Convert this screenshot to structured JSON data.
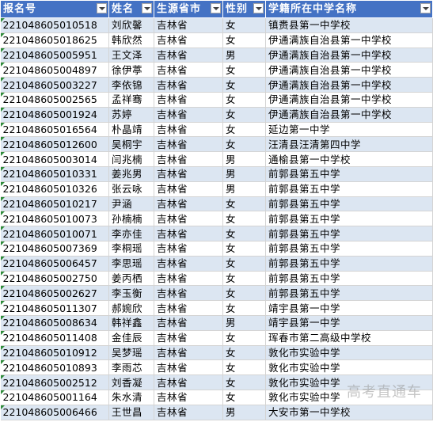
{
  "headers": [
    "报名号",
    "姓名",
    "生源省市",
    "性别",
    "学籍所在中学名称"
  ],
  "rows": [
    {
      "id": "221048605010518",
      "name": "刘欣馨",
      "province": "吉林省",
      "gender": "女",
      "school": "镇赉县第一中学校"
    },
    {
      "id": "221048605018625",
      "name": "韩欣然",
      "province": "吉林省",
      "gender": "女",
      "school": "伊通满族自治县第一中学校"
    },
    {
      "id": "221048605005951",
      "name": "王文泽",
      "province": "吉林省",
      "gender": "男",
      "school": "伊通满族自治县第一中学校"
    },
    {
      "id": "221048605004897",
      "name": "徐伊葶",
      "province": "吉林省",
      "gender": "女",
      "school": "伊通满族自治县第一中学校"
    },
    {
      "id": "221048605003227",
      "name": "李依锦",
      "province": "吉林省",
      "gender": "女",
      "school": "伊通满族自治县第一中学校"
    },
    {
      "id": "221048605002565",
      "name": "孟祥骞",
      "province": "吉林省",
      "gender": "女",
      "school": "伊通满族自治县第一中学校"
    },
    {
      "id": "221048605001924",
      "name": "苏婷",
      "province": "吉林省",
      "gender": "女",
      "school": "伊通满族自治县第一中学校"
    },
    {
      "id": "221048605016564",
      "name": "朴晶靖",
      "province": "吉林省",
      "gender": "女",
      "school": "延边第一中学"
    },
    {
      "id": "221048605012600",
      "name": "吴桐宇",
      "province": "吉林省",
      "gender": "女",
      "school": "汪清县汪清第四中学"
    },
    {
      "id": "221048605003014",
      "name": "闫兆楠",
      "province": "吉林省",
      "gender": "男",
      "school": "通榆县第一中学校"
    },
    {
      "id": "221048605010331",
      "name": "姜兆男",
      "province": "吉林省",
      "gender": "男",
      "school": "前郭县第五中学"
    },
    {
      "id": "221048605010326",
      "name": "张云咏",
      "province": "吉林省",
      "gender": "男",
      "school": "前郭县第五中学"
    },
    {
      "id": "221048605010217",
      "name": "尹涵",
      "province": "吉林省",
      "gender": "女",
      "school": "前郭县第五中学"
    },
    {
      "id": "221048605010073",
      "name": "孙楠楠",
      "province": "吉林省",
      "gender": "女",
      "school": "前郭县第五中学"
    },
    {
      "id": "221048605010071",
      "name": "李亦佳",
      "province": "吉林省",
      "gender": "女",
      "school": "前郭县第五中学"
    },
    {
      "id": "221048605007369",
      "name": "李桐瑶",
      "province": "吉林省",
      "gender": "女",
      "school": "前郭县第五中学"
    },
    {
      "id": "221048605006457",
      "name": "李思瑶",
      "province": "吉林省",
      "gender": "女",
      "school": "前郭县第五中学"
    },
    {
      "id": "221048605002750",
      "name": "姜丙栖",
      "province": "吉林省",
      "gender": "女",
      "school": "前郭县第五中学"
    },
    {
      "id": "221048605002627",
      "name": "李玉衡",
      "province": "吉林省",
      "gender": "女",
      "school": "前郭县第五中学"
    },
    {
      "id": "221048605011307",
      "name": "郝婉欣",
      "province": "吉林省",
      "gender": "女",
      "school": "靖宇县第一中学"
    },
    {
      "id": "221048605008634",
      "name": "韩祥鑫",
      "province": "吉林省",
      "gender": "男",
      "school": "靖宇县第一中学"
    },
    {
      "id": "221048605011408",
      "name": "金佳辰",
      "province": "吉林省",
      "gender": "女",
      "school": "珲春市第二高级中学校"
    },
    {
      "id": "221048605010912",
      "name": "吴梦瑶",
      "province": "吉林省",
      "gender": "女",
      "school": "敦化市实验中学"
    },
    {
      "id": "221048605010893",
      "name": "李雨芯",
      "province": "吉林省",
      "gender": "女",
      "school": "敦化市实验中学"
    },
    {
      "id": "221048605002512",
      "name": "刘香凝",
      "province": "吉林省",
      "gender": "女",
      "school": "敦化市实验中学"
    },
    {
      "id": "221048605001164",
      "name": "朱水清",
      "province": "吉林省",
      "gender": "女",
      "school": "敦化市实验中学"
    },
    {
      "id": "221048605006466",
      "name": "王世昌",
      "province": "吉林省",
      "gender": "男",
      "school": "大安市第一中学校"
    }
  ],
  "watermark": "高考直通车",
  "colors": {
    "header_bg": "#4472c4",
    "band": "#dce6f2",
    "flag": "#2e8b3a"
  }
}
